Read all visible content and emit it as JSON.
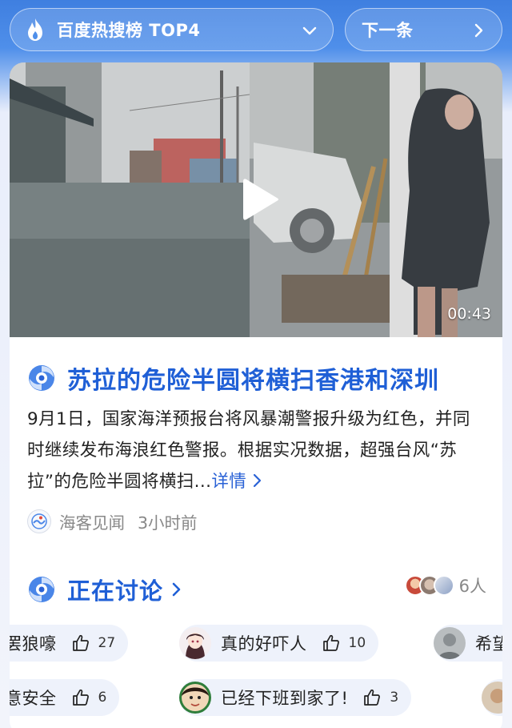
{
  "topbar": {
    "hot_label": "百度热搜榜 TOP4",
    "next_label": "下一条"
  },
  "video": {
    "duration": "00:43"
  },
  "article": {
    "title": "苏拉的危险半圆将横扫香港和深圳",
    "summary": "9月1日，国家海洋预报台将风暴潮警报升级为红色，并同时继续发布海浪红色警报。根据实况数据，超强台风“苏拉”的危险半圆将横扫...",
    "more_label": "详情",
    "source_name": "海客见闻",
    "time_ago": "3小时前"
  },
  "discussion": {
    "title": "正在讨论",
    "participants": "6人",
    "row1": [
      {
        "text": "罢狼嚎",
        "likes": "27"
      },
      {
        "text": "真的好吓人",
        "likes": "10"
      },
      {
        "text": "希望"
      }
    ],
    "row2": [
      {
        "text": "意安全",
        "likes": "6"
      },
      {
        "text": "已经下班到家了!",
        "likes": "3"
      }
    ]
  },
  "colors": {
    "accent": "#1f5fd6",
    "top_gradient": "#3f7fe0",
    "chip_bg": "#eef2fb"
  },
  "icons": {
    "hot": "flame-icon",
    "dropdown": "chevron-down-icon",
    "next": "chevron-right-icon",
    "play": "play-icon",
    "typhoon": "typhoon-spiral-icon",
    "like": "thumbs-up-icon"
  }
}
